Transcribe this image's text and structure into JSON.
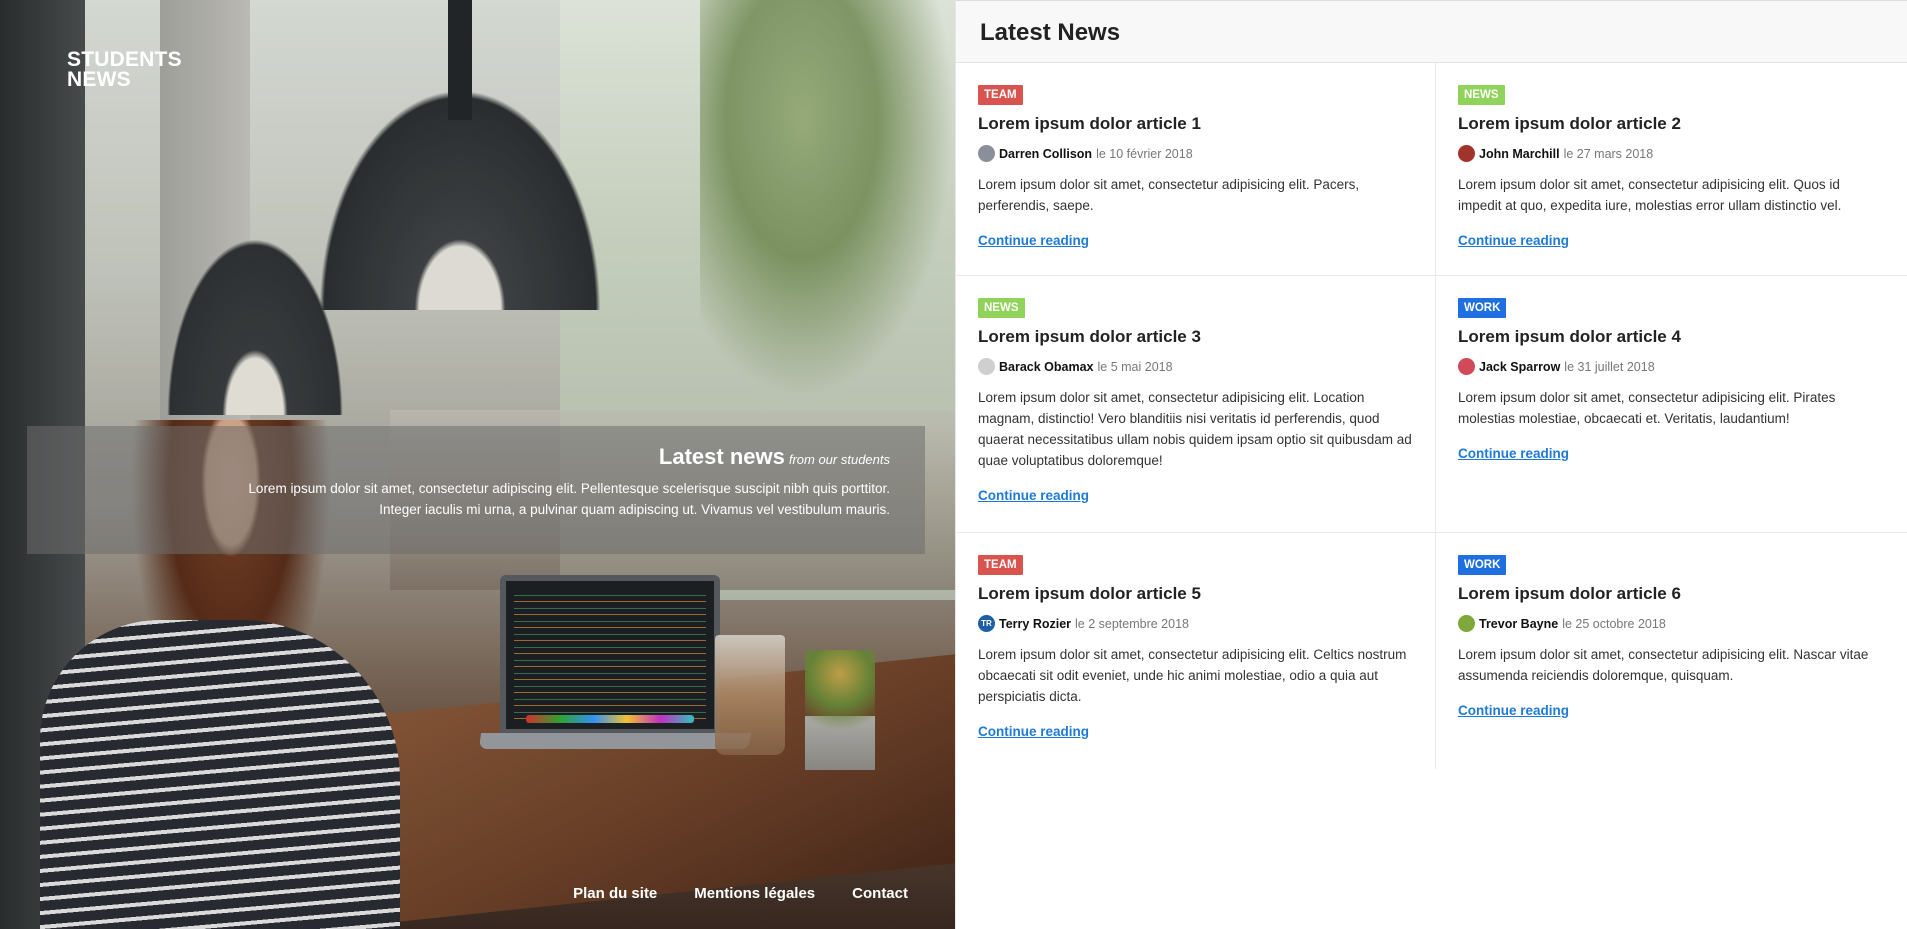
{
  "brand": {
    "line1": "STUDENTS",
    "line2": "NEWS"
  },
  "hero": {
    "title": "Latest news",
    "subtitle": "from our students",
    "description_line1": "Lorem ipsum dolor sit amet, consectetur adipiscing elit. Pellentesque scelerisque suscipit nibh quis porttitor.",
    "description_line2": "Integer iaculis mi urna, a pulvinar quam adipiscing ut. Vivamus vel vestibulum mauris."
  },
  "footer": {
    "links": [
      "Plan du site",
      "Mentions légales",
      "Contact"
    ]
  },
  "news": {
    "heading": "Latest News",
    "read_more": "Continue reading",
    "colors": {
      "TEAM": "#d9534f",
      "NEWS": "#8fd35a",
      "WORK": "#1f6fe0"
    },
    "articles": [
      {
        "tag": "TEAM",
        "title": "Lorem ipsum dolor article 1",
        "author": "Darren Collison",
        "date": "le 10 février 2018",
        "excerpt": "Lorem ipsum dolor sit amet, consectetur adipisicing elit. Pacers, perferendis, saepe.",
        "avatar_color": "#8a8f99"
      },
      {
        "tag": "NEWS",
        "title": "Lorem ipsum dolor article 2",
        "author": "John Marchill",
        "date": "le 27 mars 2018",
        "excerpt": "Lorem ipsum dolor sit amet, consectetur adipisicing elit. Quos id impedit at quo, expedita iure, molestias error ullam distinctio vel.",
        "avatar_color": "#a1332b"
      },
      {
        "tag": "NEWS",
        "title": "Lorem ipsum dolor article 3",
        "author": "Barack Obamax",
        "date": "le 5 mai 2018",
        "excerpt": "Lorem ipsum dolor sit amet, consectetur adipisicing elit. Location magnam, distinctio! Vero blanditiis nisi veritatis id perferendis, quod quaerat necessitatibus ullam nobis quidem ipsam optio sit quibusdam ad quae voluptatibus doloremque!",
        "avatar_color": "#cfcfcf"
      },
      {
        "tag": "WORK",
        "title": "Lorem ipsum dolor article 4",
        "author": "Jack Sparrow",
        "date": "le 31 juillet 2018",
        "excerpt": "Lorem ipsum dolor sit amet, consectetur adipisicing elit. Pirates molestias molestiae, obcaecati et. Veritatis, laudantium!",
        "avatar_color": "#d04a5a"
      },
      {
        "tag": "TEAM",
        "title": "Lorem ipsum dolor article 5",
        "author": "Terry Rozier",
        "date": "le 2 septembre 2018",
        "excerpt": "Lorem ipsum dolor sit amet, consectetur adipisicing elit. Celtics nostrum obcaecati sit odit eveniet, unde hic animi molestiae, odio a quia aut perspiciatis dicta.",
        "avatar_color": "#1f5fa8",
        "avatar_text": "TR"
      },
      {
        "tag": "WORK",
        "title": "Lorem ipsum dolor article 6",
        "author": "Trevor Bayne",
        "date": "le 25 octobre 2018",
        "excerpt": "Lorem ipsum dolor sit amet, consectetur adipisicing elit. Nascar vitae assumenda reiciendis doloremque, quisquam.",
        "avatar_color": "#7fa83a"
      }
    ]
  }
}
